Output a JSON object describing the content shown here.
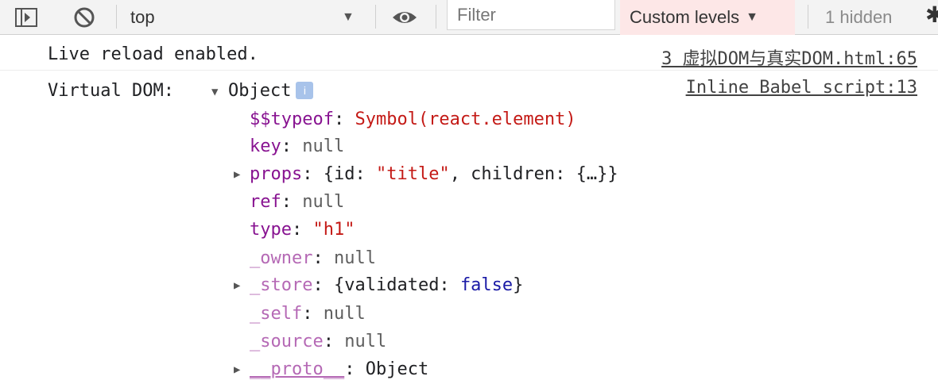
{
  "toolbar": {
    "sidebar_toggle_icon": "sidebar-toggle-icon",
    "clear_icon": "block-icon",
    "context": "top",
    "eye_icon": "eye-icon",
    "filter_placeholder": "Filter",
    "levels_label": "Custom levels",
    "hidden_count": "1 hidden",
    "settings_icon": "gear-icon"
  },
  "console": {
    "row1": {
      "text": "Live reload enabled.",
      "source": "3 虚拟DOM与真实DOM.html:65"
    },
    "row2": {
      "prefix": "Virtual DOM:",
      "object_label": "Object",
      "info": "i",
      "source": "Inline Babel script:13",
      "props": [
        {
          "key": "$$typeof",
          "value": "Symbol(react.element)"
        },
        {
          "key": "key",
          "value": "null"
        },
        {
          "key": "props",
          "preview_prefix": "{id: ",
          "preview_str": "\"title\"",
          "preview_suffix": ", children: {…}}"
        },
        {
          "key": "ref",
          "value": "null"
        },
        {
          "key": "type",
          "value": "\"h1\""
        },
        {
          "key": "_owner",
          "value": "null"
        },
        {
          "key": "_store",
          "preview_prefix": "{validated: ",
          "preview_bool": "false",
          "preview_suffix": "}"
        },
        {
          "key": "_self",
          "value": "null"
        },
        {
          "key": "_source",
          "value": "null"
        },
        {
          "key": "__proto__",
          "value": "Object"
        }
      ]
    }
  },
  "colors": {
    "key": "#881391",
    "key_dim": "#b569b5",
    "string": "#c41a16",
    "boolean": "#1a1aa6",
    "levels_bg": "#fde7e7"
  }
}
